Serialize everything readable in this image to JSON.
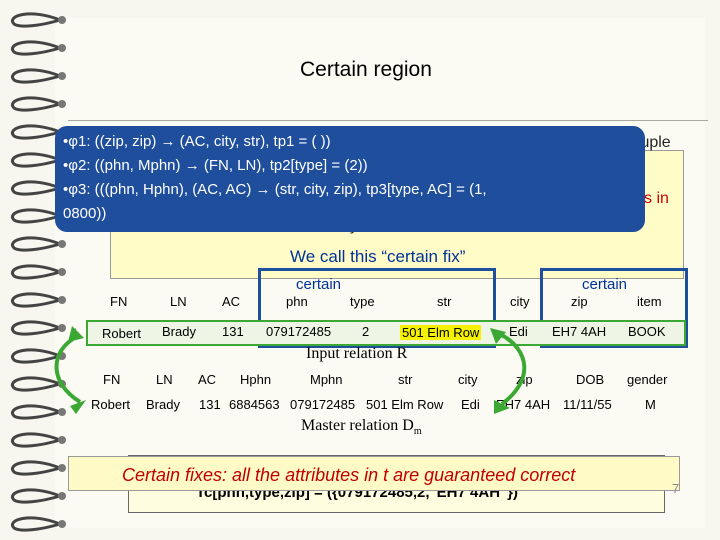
{
  "title": "Certain region",
  "rules_callout": [
    "•φ1: ((zip, zip) → (AC, city, str), tp1 = ( ))",
    "•φ2: ((phn, Mphn) → (FN, LN), tp2[type] = (2))",
    "•φ3: (((phn, Hphn), (AC, AC) → (str, city, zip), tp3[type, AC] = (1,",
    "0800))"
  ],
  "behind": {
    "tuple_fragment": "tuple",
    "s_in_fragment": "s in",
    "y_fragment": "y"
  },
  "certain_fix_label": "We call this “certain fix”",
  "certain_labels": [
    "certain",
    "certain"
  ],
  "input_relation": {
    "columns": [
      "FN",
      "LN",
      "AC",
      "phn",
      "type",
      "str",
      "city",
      "zip",
      "item"
    ],
    "row": [
      "Robert",
      "Brady",
      "131",
      "079172485",
      "2",
      "501 Elm Row",
      "Edi",
      "EH7 4AH",
      "BOOK"
    ],
    "caption": "Input relation R"
  },
  "master_relation": {
    "columns": [
      "FN",
      "LN",
      "AC",
      "Hphn",
      "Mphn",
      "str",
      "city",
      "zip",
      "DOB",
      "gender"
    ],
    "row": [
      "Robert",
      "Brady",
      "131",
      "6884563",
      "079172485",
      "501 Elm Row",
      "Edi",
      "EH7 4AH",
      "11/11/55",
      "M"
    ],
    "caption_main": "Master relation D",
    "caption_sub": "m"
  },
  "banner_text": "Certain fixes: all the attributes in t are guaranteed correct",
  "bottom_partial": "Tc[phn,type,zip] = ({079172485,2,\"EH7 4AH\"})",
  "page_number": "7",
  "colors": {
    "callout": "#1f4e9c",
    "input_row_border": "#3aa832",
    "highlight": "#f5f100",
    "banner_text": "#c00000"
  }
}
